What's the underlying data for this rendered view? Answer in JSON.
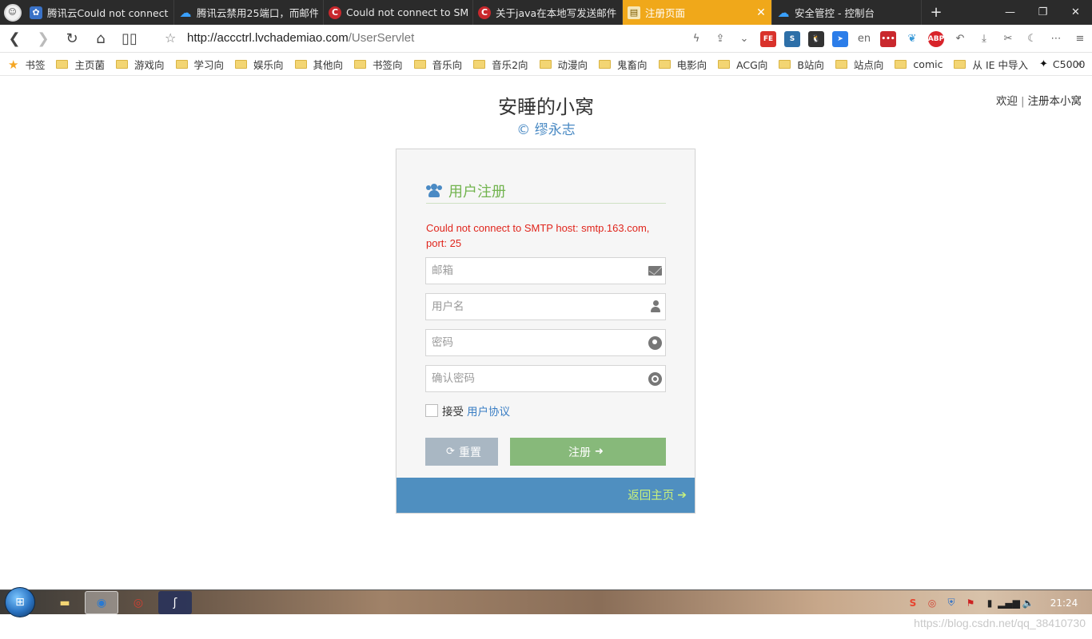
{
  "browser": {
    "tabs": [
      {
        "label": "腾讯云Could not connect",
        "icon": "baidu-paw-icon"
      },
      {
        "label": "腾讯云禁用25端口，而邮件",
        "icon": "cloud-icon"
      },
      {
        "label": "Could not connect to SM",
        "icon": "csdn-icon"
      },
      {
        "label": "关于java在本地写发送邮件",
        "icon": "csdn-icon"
      },
      {
        "label": "注册页面",
        "icon": "page-icon",
        "active": true
      },
      {
        "label": "安全管控 - 控制台",
        "icon": "cloud-icon"
      }
    ],
    "url_host": "http://accctrl.lvchademiao.com",
    "url_path": "/UserServlet",
    "bookmarks": [
      "书签",
      "主页菌",
      "游戏向",
      "学习向",
      "娱乐向",
      "其他向",
      "书签向",
      "音乐向",
      "音乐2向",
      "动漫向",
      "鬼畜向",
      "电影向",
      "ACG向",
      "B站向",
      "站点向",
      "comic",
      "从 IE 中导入",
      "C5000"
    ],
    "bookmarks_more": "»"
  },
  "page": {
    "site_title": "安睡的小窝",
    "site_credit": "© 缪永志",
    "welcome_link": "欢迎",
    "separator": "|",
    "register_link": "注册本小窝"
  },
  "register": {
    "heading": "用户注册",
    "error": "Could not connect to SMTP host: smtp.163.com, port: 25",
    "email_placeholder": "邮箱",
    "username_placeholder": "用户名",
    "password_placeholder": "密码",
    "confirm_placeholder": "确认密码",
    "agree_text": "接受",
    "agreement_link": "用户协议",
    "reset_label": "重置",
    "submit_label": "注册",
    "back_home": "返回主页"
  },
  "colors": {
    "active_tab": "#f0a81a",
    "heading_green": "#72b44f",
    "error_red": "#e0251c",
    "footer_blue": "#4f8fc0",
    "back_link": "#c8f07d",
    "submit_green": "#87b97a",
    "reset_gray": "#a9b7c3"
  },
  "taskbar": {
    "clock": "21:24"
  },
  "watermark": "https://blog.csdn.net/qq_38410730"
}
